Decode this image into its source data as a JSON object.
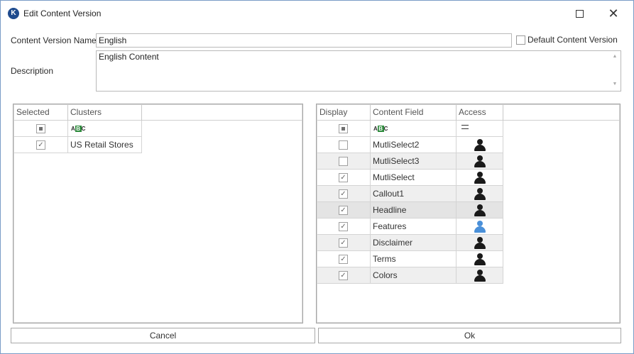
{
  "window": {
    "title": "Edit Content Version",
    "icon": "app-logo-icon"
  },
  "form": {
    "content_version_name_label": "Content Version Name",
    "content_version_name_value": "English",
    "default_content_version_label": "Default Content Version",
    "default_content_version_checked": false,
    "description_label": "Description",
    "description_value": "English Content"
  },
  "clusters_grid": {
    "columns": [
      "Selected",
      "Clusters"
    ],
    "filter_row": {
      "selected": "indeterminate",
      "clusters_icon": "abc-filter-icon"
    },
    "rows": [
      {
        "selected": true,
        "cluster": "US Retail Stores"
      }
    ]
  },
  "fields_grid": {
    "columns": [
      "Display",
      "Content Field",
      "Access"
    ],
    "filter_row": {
      "display": "indeterminate",
      "field_icon": "abc-filter-icon",
      "access_icon": "equals-icon"
    },
    "rows": [
      {
        "display": false,
        "field": "MutliSelect2",
        "access": "user-black-icon"
      },
      {
        "display": false,
        "field": "MutliSelect3",
        "access": "user-black-icon"
      },
      {
        "display": true,
        "field": "MutliSelect",
        "access": "user-black-icon"
      },
      {
        "display": true,
        "field": "Callout1",
        "access": "user-black-icon"
      },
      {
        "display": true,
        "field": "Headline",
        "access": "user-black-icon"
      },
      {
        "display": true,
        "field": "Features",
        "access": "user-blue-icon"
      },
      {
        "display": true,
        "field": "Disclaimer",
        "access": "user-black-icon"
      },
      {
        "display": true,
        "field": "Terms",
        "access": "user-black-icon"
      },
      {
        "display": true,
        "field": "Colors",
        "access": "user-black-icon"
      }
    ]
  },
  "buttons": {
    "cancel": "Cancel",
    "ok": "Ok"
  },
  "colors": {
    "window_border": "#7a9cc6",
    "alt_row": "#efefef",
    "user_blue": "#4a90d9",
    "abc_green": "#2e8b3d"
  }
}
